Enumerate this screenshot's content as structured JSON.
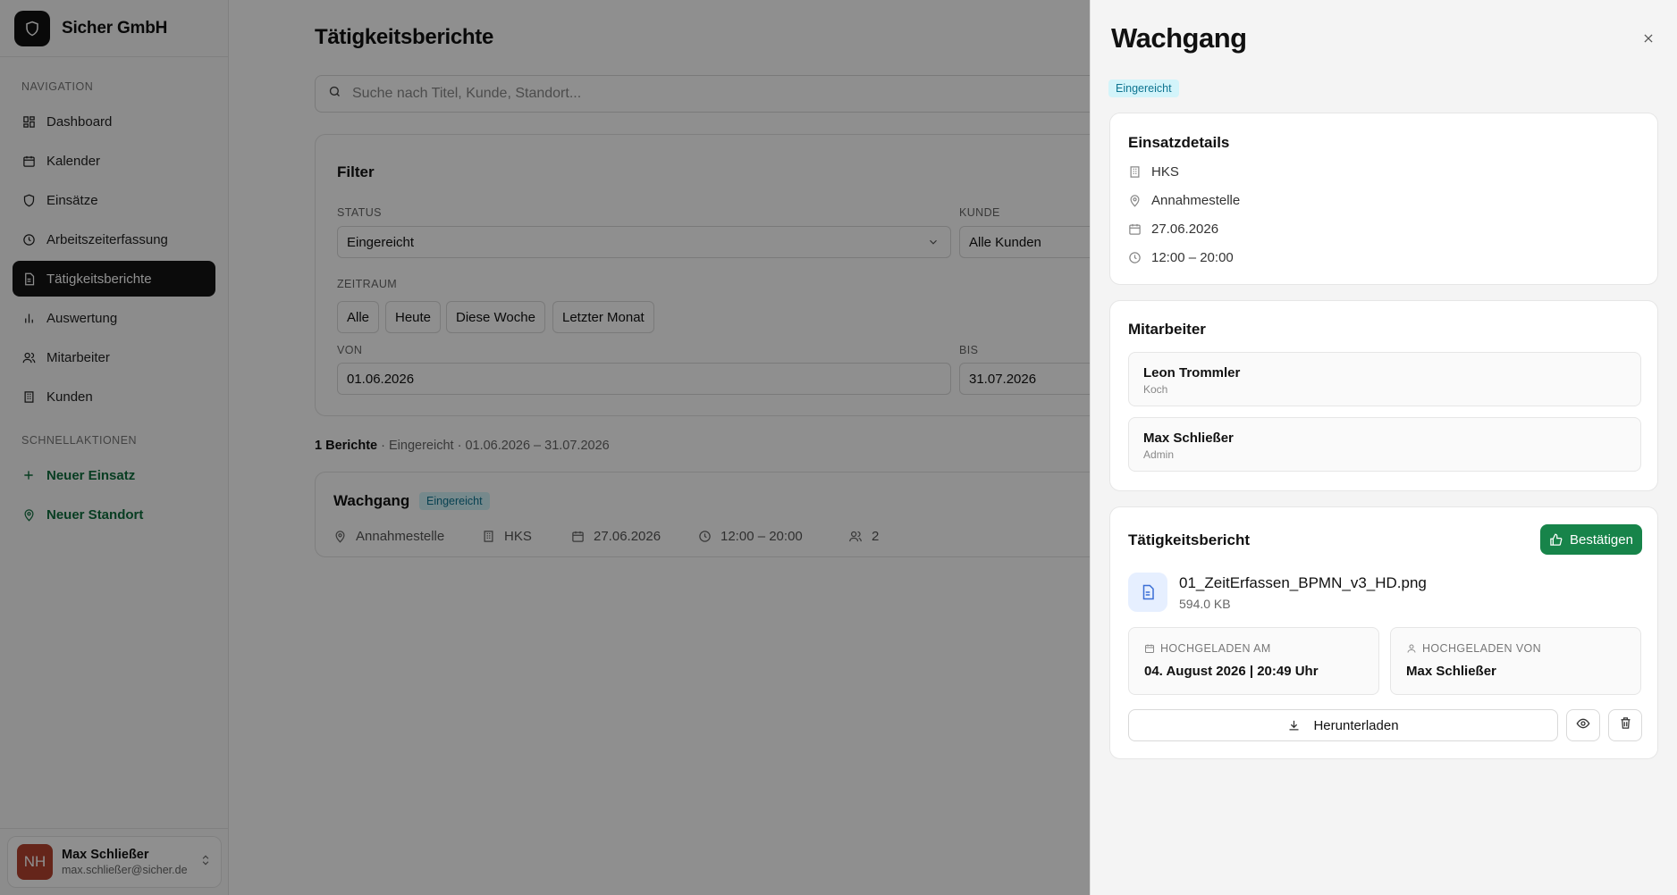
{
  "sidebar": {
    "brand": "Sicher GmbH",
    "nav_label": "NAVIGATION",
    "items": [
      {
        "label": "Dashboard"
      },
      {
        "label": "Kalender"
      },
      {
        "label": "Einsätze"
      },
      {
        "label": "Arbeitszeiterfassung"
      },
      {
        "label": "Tätigkeitsberichte"
      },
      {
        "label": "Auswertung"
      },
      {
        "label": "Mitarbeiter"
      },
      {
        "label": "Kunden"
      }
    ],
    "quick_label": "SCHNELLAKTIONEN",
    "quick": [
      {
        "label": "Neuer Einsatz"
      },
      {
        "label": "Neuer Standort"
      }
    ],
    "user": {
      "initials": "NH",
      "name": "Max Schließer",
      "email": "max.schließer@sicher.de"
    }
  },
  "main": {
    "title": "Tätigkeitsberichte",
    "search_placeholder": "Suche nach Titel, Kunde, Standort...",
    "filter": {
      "title": "Filter",
      "status_label": "STATUS",
      "status_value": "Eingereicht",
      "kunde_label": "KUNDE",
      "kunde_value": "Alle Kunden",
      "zeitraum_label": "ZEITRAUM",
      "chips": [
        "Alle",
        "Heute",
        "Diese Woche",
        "Letzter Monat"
      ],
      "von_label": "VON",
      "von_value": "01.06.2026",
      "bis_label": "BIS",
      "bis_value": "31.07.2026"
    },
    "summary": {
      "count": "1 Berichte",
      "status": "Eingereicht",
      "range": "01.06.2026 – 31.07.2026"
    },
    "report": {
      "title": "Wachgang",
      "status": "Eingereicht",
      "location": "Annahmestelle",
      "customer": "HKS",
      "date": "27.06.2026",
      "time": "12:00 – 20:00",
      "staff_count": "2"
    }
  },
  "drawer": {
    "title": "Wachgang",
    "status": "Eingereicht",
    "details": {
      "title": "Einsatzdetails",
      "customer": "HKS",
      "location": "Annahmestelle",
      "date": "27.06.2026",
      "time": "12:00 – 20:00"
    },
    "staff": {
      "title": "Mitarbeiter",
      "people": [
        {
          "name": "Leon Trommler",
          "role": "Koch"
        },
        {
          "name": "Max Schließer",
          "role": "Admin"
        }
      ]
    },
    "report": {
      "title": "Tätigkeitsbericht",
      "confirm_label": "Bestätigen",
      "file_name": "01_ZeitErfassen_BPMN_v3_HD.png",
      "file_size": "594.0 KB",
      "uploaded_at_label": "HOCHGELADEN AM",
      "uploaded_at": "04. August 2026 | 20:49 Uhr",
      "uploaded_by_label": "HOCHGELADEN VON",
      "uploaded_by": "Max Schließer",
      "download_label": "Herunterladen"
    }
  },
  "colors": {
    "accent_green": "#17844a",
    "badge_bg": "#d3f4fa",
    "badge_text": "#0e7490",
    "active_nav": "#151515"
  }
}
